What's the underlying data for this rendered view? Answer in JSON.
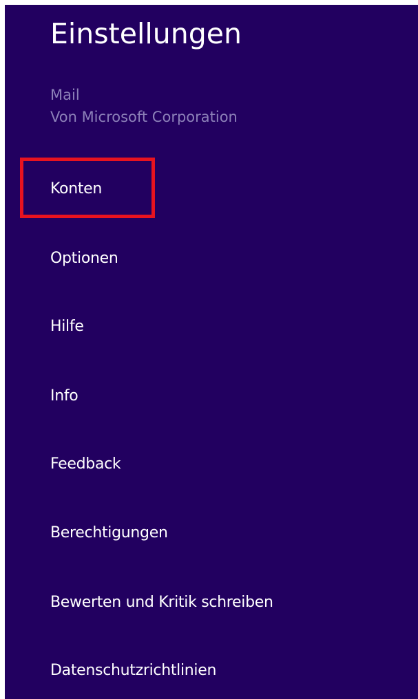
{
  "panel": {
    "title": "Einstellungen",
    "app_name": "Mail",
    "publisher": "Von Microsoft Corporation"
  },
  "menu": {
    "items": [
      {
        "label": "Konten"
      },
      {
        "label": "Optionen"
      },
      {
        "label": "Hilfe"
      },
      {
        "label": "Info"
      },
      {
        "label": "Feedback"
      },
      {
        "label": "Berechtigungen"
      },
      {
        "label": "Bewerten und Kritik schreiben"
      },
      {
        "label": "Datenschutzrichtlinien"
      }
    ]
  },
  "colors": {
    "panel_background": "#220060",
    "text_primary": "#ffffff",
    "text_secondary": "#8c80b8",
    "highlight": "#e8131f"
  }
}
